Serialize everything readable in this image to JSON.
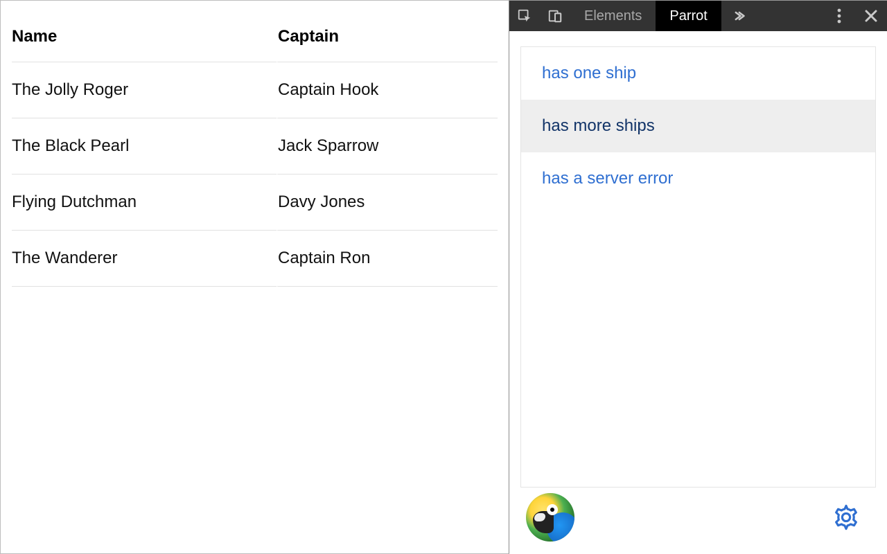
{
  "table": {
    "headers": {
      "name": "Name",
      "captain": "Captain"
    },
    "rows": [
      {
        "name": "The Jolly Roger",
        "captain": "Captain Hook"
      },
      {
        "name": "The Black Pearl",
        "captain": "Jack Sparrow"
      },
      {
        "name": "Flying Dutchman",
        "captain": "Davy Jones"
      },
      {
        "name": "The Wanderer",
        "captain": "Captain Ron"
      }
    ]
  },
  "devtools": {
    "tabs": {
      "elements": "Elements",
      "parrot": "Parrot"
    },
    "active_tab": "parrot"
  },
  "scenarios": {
    "items": [
      {
        "label": "has one ship",
        "selected": false
      },
      {
        "label": "has more ships",
        "selected": true
      },
      {
        "label": "has a server error",
        "selected": false
      }
    ]
  }
}
